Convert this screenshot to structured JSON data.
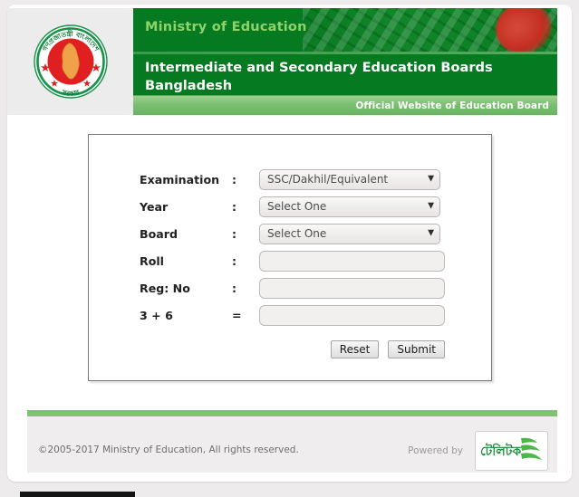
{
  "header": {
    "emblem_alt": "Government of Bangladesh national emblem",
    "ministry_line": "Ministry of Education",
    "board_title": "Intermediate and Secondary Education Boards Bangladesh",
    "official_strip": "Official Website of Education Board",
    "banner_green": "#067a20",
    "ministry_text_color": "#8dd36a",
    "strip_green": "#7cbf72"
  },
  "form": {
    "rows": [
      {
        "label": "Examination",
        "separator": ":",
        "field": "select",
        "value": "SSC/Dakhil/Equivalent"
      },
      {
        "label": "Year",
        "separator": ":",
        "field": "select",
        "value": "Select One"
      },
      {
        "label": "Board",
        "separator": ":",
        "field": "select",
        "value": "Select One"
      },
      {
        "label": "Roll",
        "separator": ":",
        "field": "text",
        "value": ""
      },
      {
        "label": "Reg: No",
        "separator": ":",
        "field": "text",
        "value": ""
      },
      {
        "label": "3 + 6",
        "separator": "=",
        "field": "text",
        "value": ""
      }
    ],
    "examination_label": "Examination",
    "examination_sep": ":",
    "examination_value": "SSC/Dakhil/Equivalent",
    "year_label": "Year",
    "year_sep": ":",
    "year_value": "Select One",
    "board_label": "Board",
    "board_sep": ":",
    "board_value": "Select One",
    "roll_label": "Roll",
    "roll_sep": ":",
    "roll_value": "",
    "reg_label": "Reg: No",
    "reg_sep": ":",
    "reg_value": "",
    "captcha_label": "3 + 6",
    "captcha_sep": "=",
    "captcha_value": "",
    "reset_label": "Reset",
    "submit_label": "Submit",
    "dropdown_icon": "chevron-down-icon"
  },
  "footer": {
    "copyright": "©2005-2017 Ministry of Education, All rights reserved.",
    "powered_by": "Powered by",
    "partner_logo_text": "টেলিটক",
    "partner_logo_name": "teletalk-logo",
    "rule_color": "#7ec46e"
  }
}
